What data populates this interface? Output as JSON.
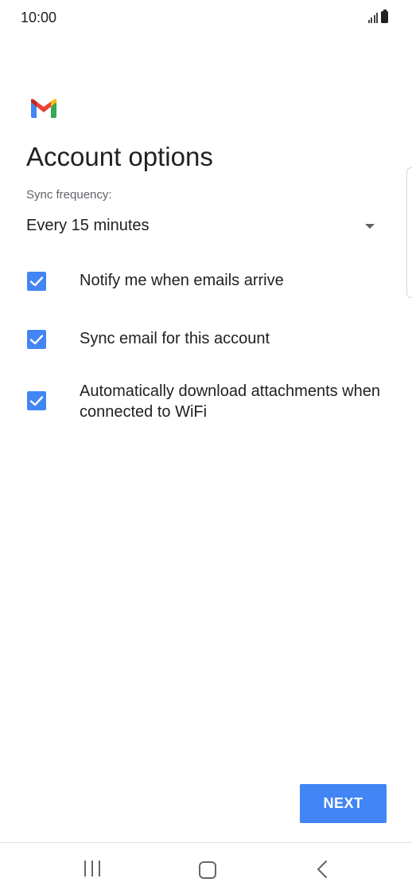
{
  "status_bar": {
    "time": "10:00"
  },
  "page": {
    "title": "Account options",
    "sync_frequency_label": "Sync frequency:",
    "sync_frequency_value": "Every 15 minutes"
  },
  "options": [
    {
      "label": "Notify me when emails arrive",
      "checked": true
    },
    {
      "label": "Sync email for this account",
      "checked": true
    },
    {
      "label": "Automatically download attachments when connected to WiFi",
      "checked": true
    }
  ],
  "buttons": {
    "next_label": "NEXT"
  },
  "colors": {
    "accent": "#4285f4",
    "gmail_red": "#ea4335",
    "gmail_blue": "#4285f4",
    "gmail_green": "#34a853",
    "gmail_yellow": "#fbbc04"
  },
  "icons": [
    "signal-icon",
    "battery-icon",
    "gmail-logo-icon",
    "dropdown-arrow-icon",
    "check-icon",
    "recents-icon",
    "home-icon",
    "back-icon"
  ]
}
